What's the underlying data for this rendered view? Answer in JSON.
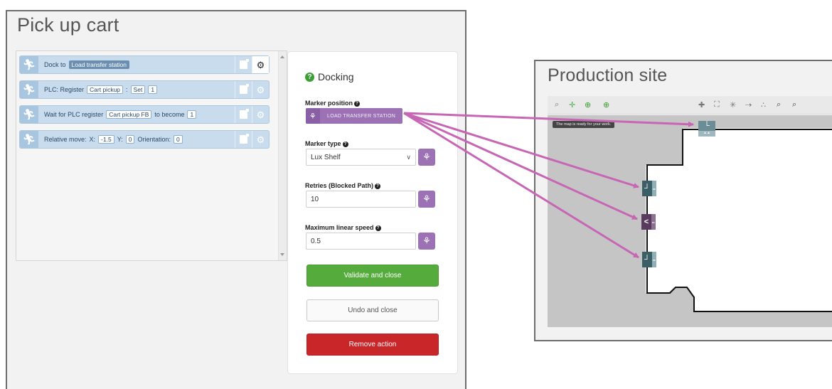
{
  "left_window": {
    "title": "Pick up cart",
    "actions": [
      {
        "prefix": "Dock to",
        "tag": "Load transfer station"
      },
      {
        "prefix": "PLC: Register",
        "box1": "Cart pickup",
        "sep1": ":",
        "box2": "Set",
        "box3": "1"
      },
      {
        "prefix": "Wait for PLC register",
        "box1": "Cart pickup FB",
        "mid": "to become",
        "box2": "1"
      },
      {
        "prefix": "Relative move:",
        "x_label": "X:",
        "x_val": "-1.5",
        "y_label": "Y:",
        "y_val": "0",
        "o_label": "Orientation:",
        "o_val": "0"
      }
    ]
  },
  "docking_panel": {
    "title": "Docking",
    "marker_position": {
      "label": "Marker position",
      "value": "LOAD TRANSFER STATION"
    },
    "marker_type": {
      "label": "Marker type",
      "value": "Lux Shelf"
    },
    "retries": {
      "label": "Retries (Blocked Path)",
      "value": "10"
    },
    "max_speed": {
      "label": "Maximum linear speed",
      "value": "0.5"
    },
    "validate_label": "Validate and close",
    "undo_label": "Undo and close",
    "remove_label": "Remove action"
  },
  "right_window": {
    "title": "Production site",
    "toast": "The map is ready for your work."
  },
  "colors": {
    "accent_purple": "#9c72b5",
    "validate_green": "#55ac3c",
    "remove_red": "#c9262a",
    "action_blue": "#c8dced",
    "arrow_pink": "#c766b4"
  },
  "icons": {
    "action_row": "running-person-icon",
    "copy": "copy-icon",
    "settings": "gear-icon",
    "help": "question-circle-icon",
    "marker_symbol": "marker-symbol-icon"
  }
}
